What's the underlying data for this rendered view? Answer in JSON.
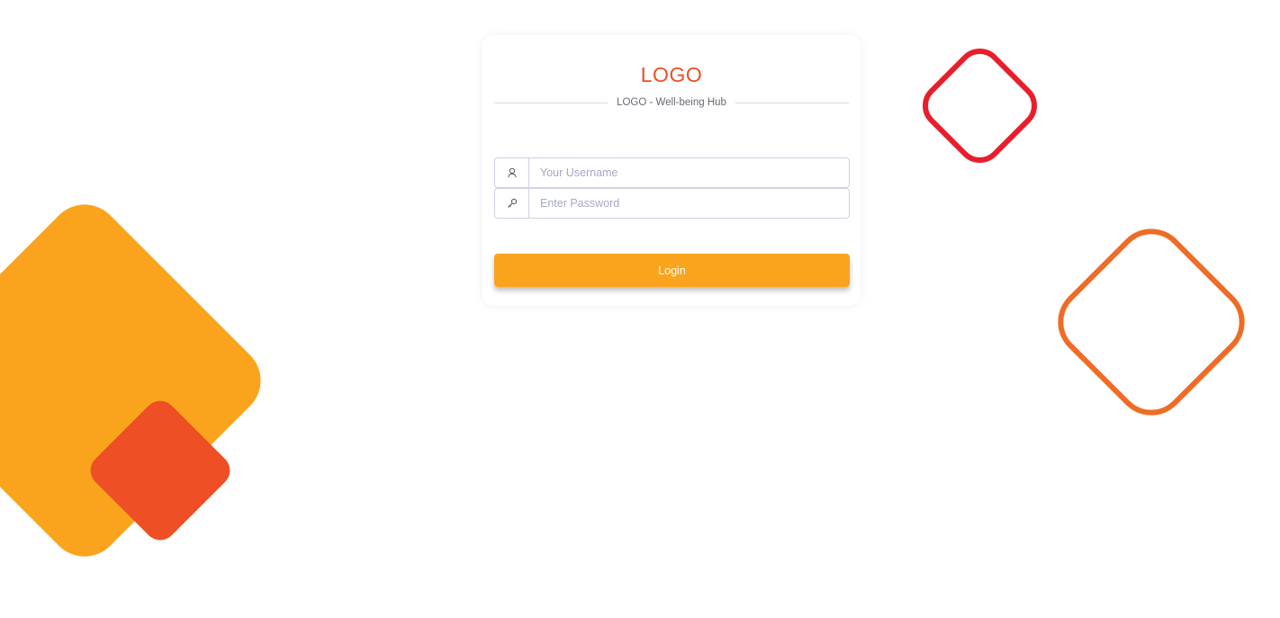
{
  "brand": {
    "logo_text": "LOGO",
    "subtitle": "LOGO - Well-being Hub"
  },
  "login_form": {
    "username": {
      "icon": "user-icon",
      "value": "",
      "placeholder": "Your Username"
    },
    "password": {
      "icon": "key-icon",
      "value": "",
      "placeholder": "Enter Password"
    },
    "submit_label": "Login"
  },
  "colors": {
    "accent_orange": "#faa41e",
    "logo_red_orange": "#ee4f24",
    "outline_red": "#e81e2b",
    "outline_orange": "#ef6c26",
    "input_border": "#cfd1e6",
    "placeholder": "#a6a8c8"
  }
}
